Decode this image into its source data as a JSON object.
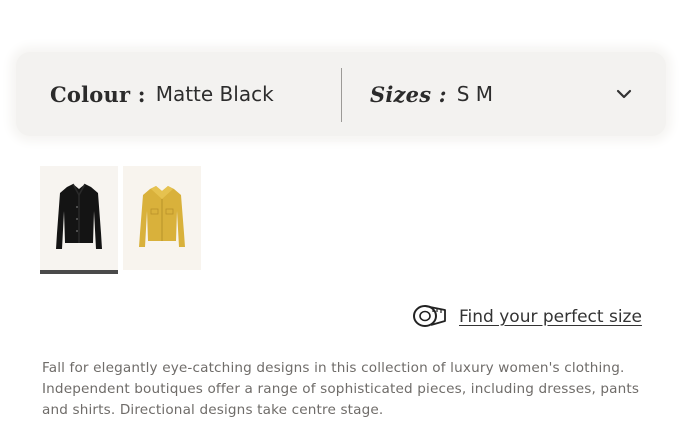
{
  "selector": {
    "colour_label": "Colour :",
    "colour_value": "Matte Black",
    "sizes_label": "Sizes :",
    "sizes_value": "S M",
    "dropdown_icon": "chevron-down-icon"
  },
  "swatches": [
    {
      "name": "black-jacket",
      "color": "#141414",
      "selected": true
    },
    {
      "name": "yellow-jacket",
      "color": "#dcb43c",
      "selected": false
    }
  ],
  "size_guide": {
    "icon": "tape-measure-icon",
    "label": "Find your perfect size"
  },
  "description": "Fall for elegantly eye-catching designs in this collection of luxury women's clothing. Independent boutiques offer a range of sophisticated pieces, including dresses, pants and shirts. Directional designs take centre stage."
}
